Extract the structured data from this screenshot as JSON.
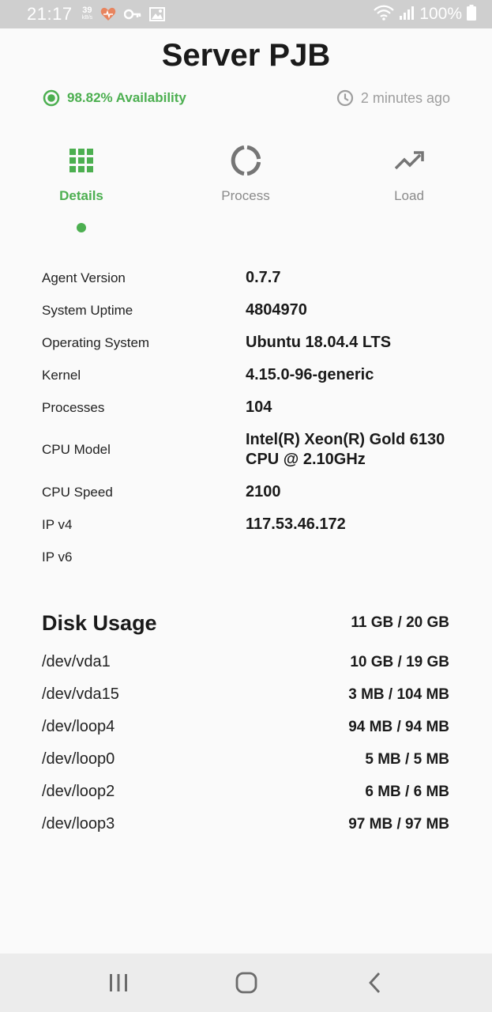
{
  "status_bar": {
    "time": "21:17",
    "net_speed_value": "39",
    "net_speed_unit": "kB/s",
    "battery": "100%",
    "icons": [
      "heart-icon",
      "key-icon",
      "image-icon",
      "wifi-icon",
      "signal-icon",
      "battery-icon"
    ],
    "heart_color": "#e8845e"
  },
  "header": {
    "title": "Server PJB",
    "availability": "98.82% Availability",
    "updated": "2 minutes ago"
  },
  "tabs": [
    {
      "label": "Details",
      "icon": "grid-icon",
      "active": true
    },
    {
      "label": "Process",
      "icon": "donut-icon",
      "active": false
    },
    {
      "label": "Load",
      "icon": "trending-up-icon",
      "active": false
    }
  ],
  "details": [
    {
      "key": "Agent Version",
      "value": "0.7.7"
    },
    {
      "key": "System Uptime",
      "value": "4804970"
    },
    {
      "key": "Operating System",
      "value": "Ubuntu 18.04.4 LTS"
    },
    {
      "key": "Kernel",
      "value": "4.15.0-96-generic"
    },
    {
      "key": "Processes",
      "value": "104"
    },
    {
      "key": "CPU Model",
      "value": "Intel(R) Xeon(R) Gold 6130 CPU @ 2.10GHz"
    },
    {
      "key": "CPU Speed",
      "value": "2100"
    },
    {
      "key": "IP v4",
      "value": "117.53.46.172"
    },
    {
      "key": "IP v6",
      "value": ""
    }
  ],
  "disk_usage": {
    "title": "Disk Usage",
    "total": "11 GB / 20 GB",
    "devices": [
      {
        "device": "/dev/vda1",
        "usage": "10 GB / 19 GB"
      },
      {
        "device": "/dev/vda15",
        "usage": "3 MB / 104 MB"
      },
      {
        "device": "/dev/loop4",
        "usage": "94 MB / 94 MB"
      },
      {
        "device": "/dev/loop0",
        "usage": "5 MB / 5 MB"
      },
      {
        "device": "/dev/loop2",
        "usage": "6 MB / 6 MB"
      },
      {
        "device": "/dev/loop3",
        "usage": "97 MB / 97 MB"
      }
    ]
  },
  "nav_bar": {
    "icons": [
      "recents-icon",
      "home-icon",
      "back-icon"
    ]
  },
  "colors": {
    "accent": "#4caf50",
    "muted": "#9e9e9e",
    "icon_gray": "#757575"
  }
}
